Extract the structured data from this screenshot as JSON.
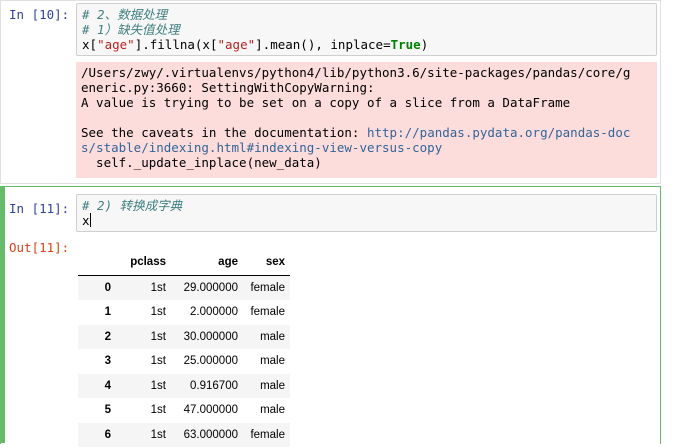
{
  "cells": [
    {
      "prompt": "In [10]:",
      "code": {
        "comment1": "# 2、数据处理",
        "comment2": "# 1）缺失值处理",
        "line3": {
          "a": "x[",
          "s1": "\"age\"",
          "b": "].fillna(x[",
          "s2": "\"age\"",
          "c": "].mean(), inplace=",
          "kw": "True",
          "d": ")"
        }
      },
      "stderr": {
        "line1": "/Users/zwy/.virtualenvs/python4/lib/python3.6/site-packages/pandas/core/g",
        "line2": "eneric.py:3660: SettingWithCopyWarning:",
        "line3": "A value is trying to be set on a copy of a slice from a DataFrame",
        "line5_prefix": "See the caveats in the documentation: ",
        "line5_link": "http://pandas.pydata.org/pandas-doc",
        "line6_link": "s/stable/indexing.html#indexing-view-versus-copy",
        "line7": "  self._update_inplace(new_data)"
      }
    },
    {
      "prompt": "In [11]:",
      "code": {
        "comment1": "# 2) 转换成字典",
        "line2": "x"
      },
      "out_prompt": "Out[11]:",
      "table": {
        "columns": [
          "",
          "pclass",
          "age",
          "sex"
        ],
        "rows": [
          {
            "index": "0",
            "pclass": "1st",
            "age": "29.000000",
            "sex": "female"
          },
          {
            "index": "1",
            "pclass": "1st",
            "age": "2.000000",
            "sex": "female"
          },
          {
            "index": "2",
            "pclass": "1st",
            "age": "30.000000",
            "sex": "male"
          },
          {
            "index": "3",
            "pclass": "1st",
            "age": "25.000000",
            "sex": "male"
          },
          {
            "index": "4",
            "pclass": "1st",
            "age": "0.916700",
            "sex": "male"
          },
          {
            "index": "5",
            "pclass": "1st",
            "age": "47.000000",
            "sex": "male"
          },
          {
            "index": "6",
            "pclass": "1st",
            "age": "63.000000",
            "sex": "female"
          }
        ]
      }
    }
  ]
}
